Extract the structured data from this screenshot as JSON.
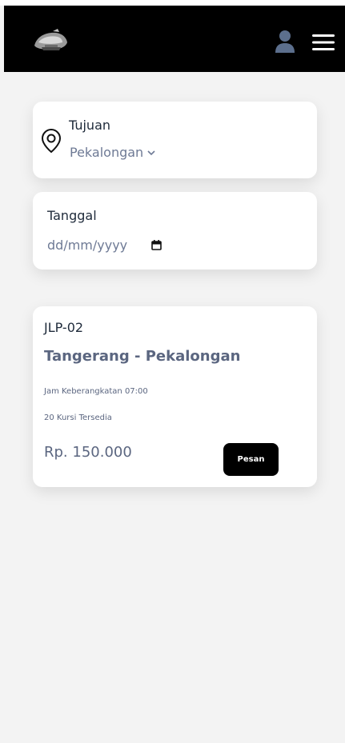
{
  "navbar": {
    "logo_icon": "bus-logo-icon",
    "user_icon": "user-icon",
    "menu_icon": "hamburger-menu-icon",
    "background": "#000000"
  },
  "search": {
    "destination_label": "Tujuan",
    "destination_value": "Pekalongan",
    "destination_icon": "location-pin-icon",
    "date_label": "Tanggal",
    "date_placeholder": "dd/mm/yyyy",
    "date_icon": "calendar-icon"
  },
  "trips": [
    {
      "code": "JLP-02",
      "route": "Tangerang - Pekalongan",
      "departure": "Jam Keberangkatan 07:00",
      "seats": "20 Kursi Tersedia",
      "price": "Rp. 150.000",
      "book_label": "Pesan"
    }
  ],
  "colors": {
    "page_background": "#f3f3f3",
    "card_background": "#ffffff",
    "text_dark": "#1e2a3a",
    "text_muted": "#5b6680",
    "accent": "#000000"
  }
}
